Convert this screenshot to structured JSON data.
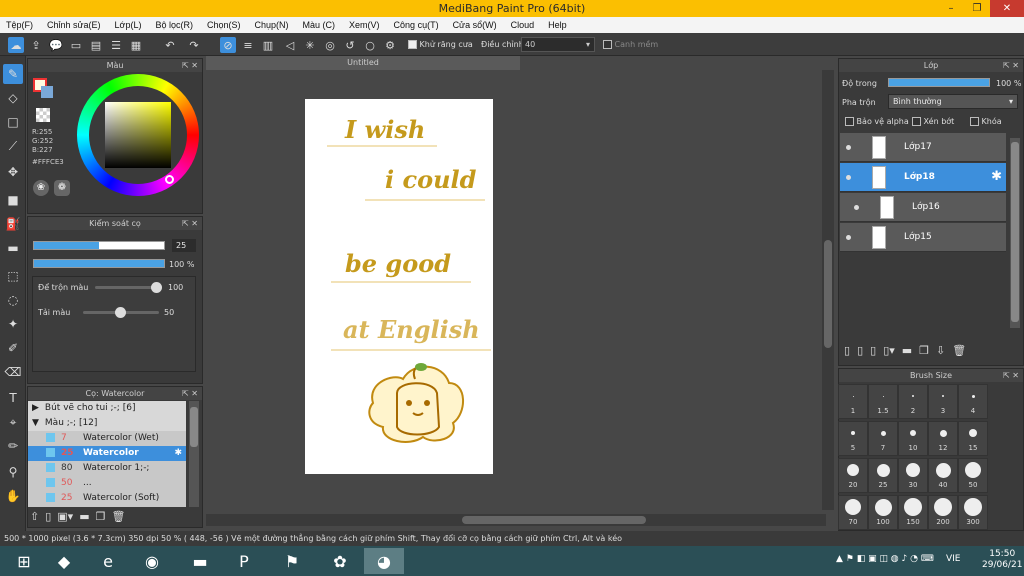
{
  "app": {
    "title": "MediBang Paint Pro (64bit)"
  },
  "window_controls": {
    "minimize": "–",
    "maximize": "❐",
    "close": "✕"
  },
  "menu": [
    "Tệp(F)",
    "Chỉnh sửa(E)",
    "Lớp(L)",
    "Bộ lọc(R)",
    "Chọn(S)",
    "Chụp(N)",
    "Màu (C)",
    "Xem(V)",
    "Công cụ(T)",
    "Cửa sổ(W)",
    "Cloud",
    "Help"
  ],
  "toolbar": {
    "antialias_label": "Khử răng cưa",
    "adjust_label": "Điều chỉnh",
    "adjust_value": "40",
    "snap_label": "Canh mềm"
  },
  "color_panel": {
    "title": "Màu",
    "r": "R:255",
    "g": "G:252",
    "b": "B:227",
    "hex": "#FFFCE3",
    "fg_color": "#fffce3",
    "bg_color": "#7aa8d8"
  },
  "brush_control": {
    "title": "Kiểm soát cọ",
    "size_value": "25",
    "opacity_value": "100 %",
    "size_fraction": 0.5,
    "opacity_fraction": 1.0,
    "blend_label": "Để trộn màu",
    "blend_value": "100",
    "reload_label": "Tải màu",
    "reload_value": "50"
  },
  "brush_list": {
    "title": "Cọ: Watercolor",
    "groups": [
      {
        "label": "Bút vẽ cho tui ;-; [6]",
        "expanded": false
      },
      {
        "label": "Màu ;-; [12]",
        "expanded": true
      }
    ],
    "items": [
      {
        "size": "7",
        "name": "Watercolor (Wet)",
        "selected": false
      },
      {
        "size": "25",
        "name": "Watercolor",
        "selected": true
      },
      {
        "size": "80",
        "name": "Watercolor 1;-;",
        "selected": false
      },
      {
        "size": "50",
        "name": "...",
        "selected": false
      },
      {
        "size": "25",
        "name": "Watercolor (Soft)",
        "selected": false
      }
    ]
  },
  "document": {
    "tab": "Untitled",
    "lines": [
      "I wish",
      "i could",
      "be good",
      "at English"
    ]
  },
  "layer_panel": {
    "title": "Lớp",
    "opacity_label": "Độ trong",
    "opacity_value": "100 %",
    "blend_label": "Pha trộn",
    "blend_value": "Bình thường",
    "protect_alpha": "Bảo vệ alpha",
    "clip": "Xén bớt",
    "lock": "Khóa",
    "layers": [
      {
        "name": "Lớp17",
        "selected": false
      },
      {
        "name": "Lớp18",
        "selected": true
      },
      {
        "name": "Lớp16",
        "selected": false
      },
      {
        "name": "Lớp15",
        "selected": false
      }
    ]
  },
  "brush_size_panel": {
    "title": "Brush Size",
    "sizes": [
      "1",
      "1.5",
      "2",
      "3",
      "4",
      "5",
      "7",
      "10",
      "12",
      "15",
      "20",
      "25",
      "30",
      "40",
      "50",
      "70",
      "100",
      "150",
      "200",
      "300"
    ]
  },
  "status": {
    "text": "500 * 1000 pixel  (3.6 * 7.3cm)  350 dpi  50 %  ( 448, -56 )  Vẽ một đường thẳng bằng cách giữ phím Shift, Thay đổi cỡ cọ bằng cách giữ phím Ctrl, Alt và kéo"
  },
  "taskbar": {
    "time": "15:50",
    "date": "29/06/21",
    "lang": "VIE"
  }
}
